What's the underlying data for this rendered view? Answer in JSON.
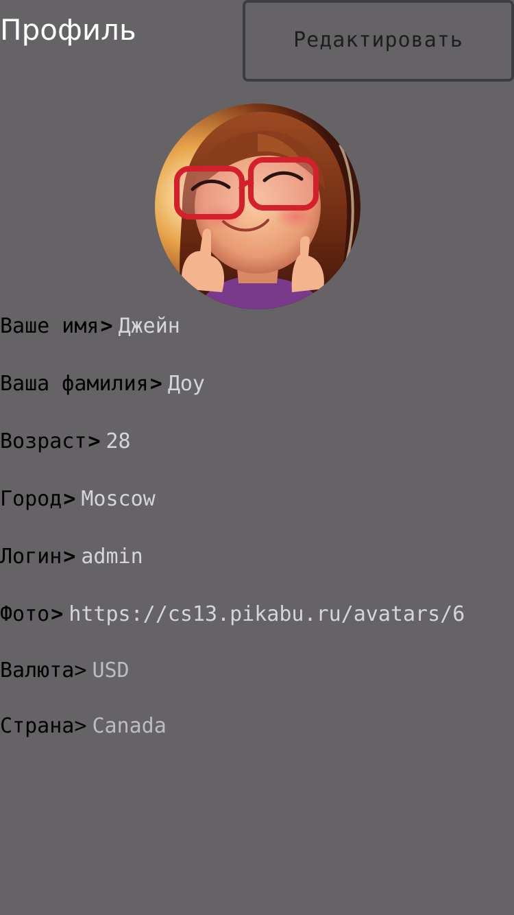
{
  "header": {
    "title": "Профиль",
    "edit_label": "Редактировать"
  },
  "profile": {
    "avatar_description": "avatar-illustration",
    "fields": [
      {
        "label": "Ваше имя",
        "value": "Джейн"
      },
      {
        "label": "Ваша фамилия",
        "value": "Доу"
      },
      {
        "label": "Возраст",
        "value": "28"
      },
      {
        "label": "Город",
        "value": "Moscow"
      },
      {
        "label": "Логин",
        "value": "admin"
      },
      {
        "label": "Фото",
        "value": "https://cs13.pikabu.ru/avatars/6"
      },
      {
        "label": "Валюта",
        "value": "USD"
      },
      {
        "label": "Страна",
        "value": "Canada"
      }
    ],
    "separator": ">"
  },
  "colors": {
    "background": "#656366",
    "title_text": "#ffffff",
    "label_text": "#000000",
    "value_text": "#d6d6d8",
    "button_border": "#3d3c3f"
  }
}
